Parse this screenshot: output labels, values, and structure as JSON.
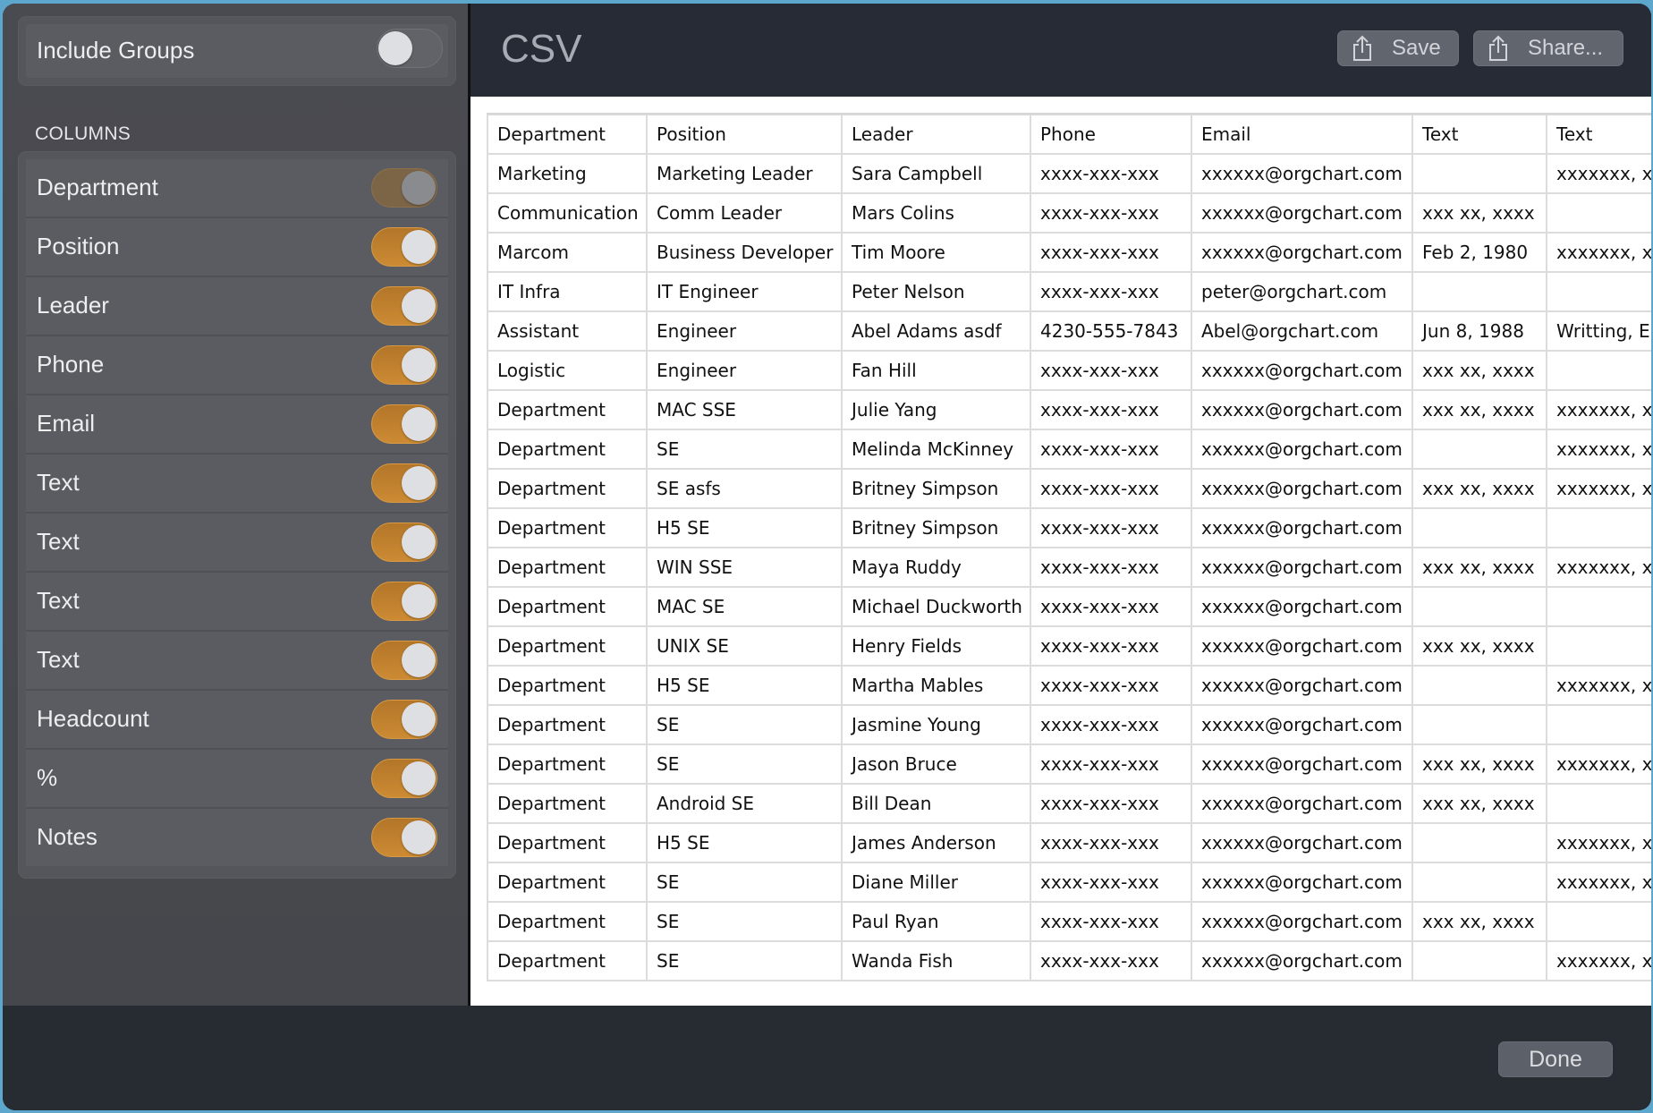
{
  "sidebar": {
    "include_groups": {
      "label": "Include Groups",
      "on": false
    },
    "columns_title": "COLUMNS",
    "columns": [
      {
        "label": "Department",
        "on": true,
        "disabled": true
      },
      {
        "label": "Position",
        "on": true
      },
      {
        "label": "Leader",
        "on": true
      },
      {
        "label": "Phone",
        "on": true
      },
      {
        "label": "Email",
        "on": true
      },
      {
        "label": "Text",
        "on": true
      },
      {
        "label": "Text",
        "on": true
      },
      {
        "label": "Text",
        "on": true
      },
      {
        "label": "Text",
        "on": true
      },
      {
        "label": "Headcount",
        "on": true
      },
      {
        "label": "%",
        "on": true
      },
      {
        "label": "Notes",
        "on": true
      }
    ]
  },
  "header": {
    "title": "CSV",
    "save_label": "Save",
    "share_label": "Share...",
    "save_icon": "share-box-icon",
    "share_icon": "share-box-icon"
  },
  "table": {
    "headers": [
      "Department",
      "Position",
      "Leader",
      "Phone",
      "Email",
      "Text",
      "Text"
    ],
    "rows": [
      [
        "Marketing",
        "Marketing Leader",
        "Sara Campbell",
        "xxxx-xxx-xxx",
        "xxxxxx@orgchart.com",
        "",
        "xxxxxxx, x"
      ],
      [
        "Communication",
        "Comm Leader",
        "Mars Colins",
        "xxxx-xxx-xxx",
        "xxxxxx@orgchart.com",
        "xxx xx, xxxx",
        ""
      ],
      [
        "Marcom",
        "Business Developer",
        "Tim Moore",
        "xxxx-xxx-xxx",
        "xxxxxx@orgchart.com",
        "Feb 2, 1980",
        "xxxxxxx, x"
      ],
      [
        "IT Infra",
        "IT Engineer",
        "Peter Nelson",
        "xxxx-xxx-xxx",
        "peter@orgchart.com",
        "",
        ""
      ],
      [
        "Assistant",
        "Engineer",
        "Abel Adams asdf",
        "4230-555-7843",
        "Abel@orgchart.com",
        "Jun 8, 1988",
        "Writting, E"
      ],
      [
        "Logistic",
        "Engineer",
        "Fan Hill",
        "xxxx-xxx-xxx",
        "xxxxxx@orgchart.com",
        "xxx xx, xxxx",
        ""
      ],
      [
        "Department",
        "MAC SSE",
        "Julie Yang",
        "xxxx-xxx-xxx",
        "xxxxxx@orgchart.com",
        "xxx xx, xxxx",
        "xxxxxxx, x"
      ],
      [
        "Department",
        "SE",
        "Melinda McKinney",
        "xxxx-xxx-xxx",
        "xxxxxx@orgchart.com",
        "",
        "xxxxxxx, x"
      ],
      [
        "Department",
        "SE asfs",
        "Britney Simpson",
        "xxxx-xxx-xxx",
        "xxxxxx@orgchart.com",
        "xxx xx, xxxx",
        "xxxxxxx, x"
      ],
      [
        "Department",
        "H5 SE",
        "Britney Simpson",
        "xxxx-xxx-xxx",
        "xxxxxx@orgchart.com",
        "",
        ""
      ],
      [
        "Department",
        "WIN SSE",
        "Maya Ruddy",
        "xxxx-xxx-xxx",
        "xxxxxx@orgchart.com",
        "xxx xx, xxxx",
        "xxxxxxx, x"
      ],
      [
        "Department",
        "MAC SE",
        "Michael Duckworth",
        "xxxx-xxx-xxx",
        "xxxxxx@orgchart.com",
        "",
        ""
      ],
      [
        "Department",
        "UNIX SE",
        "Henry Fields",
        "xxxx-xxx-xxx",
        "xxxxxx@orgchart.com",
        "xxx xx, xxxx",
        ""
      ],
      [
        "Department",
        "H5 SE",
        "Martha Mables",
        "xxxx-xxx-xxx",
        "xxxxxx@orgchart.com",
        "",
        "xxxxxxx, x"
      ],
      [
        "Department",
        "SE",
        "Jasmine Young",
        "xxxx-xxx-xxx",
        "xxxxxx@orgchart.com",
        "",
        ""
      ],
      [
        "Department",
        "SE",
        "Jason Bruce",
        "xxxx-xxx-xxx",
        "xxxxxx@orgchart.com",
        "xxx xx, xxxx",
        "xxxxxxx, x"
      ],
      [
        "Department",
        "Android SE",
        "Bill Dean",
        "xxxx-xxx-xxx",
        "xxxxxx@orgchart.com",
        "xxx xx, xxxx",
        ""
      ],
      [
        "Department",
        "H5 SE",
        "James Anderson",
        "xxxx-xxx-xxx",
        "xxxxxx@orgchart.com",
        "",
        "xxxxxxx, x"
      ],
      [
        "Department",
        "SE",
        "Diane Miller",
        "xxxx-xxx-xxx",
        "xxxxxx@orgchart.com",
        "",
        "xxxxxxx, x"
      ],
      [
        "Department",
        "SE",
        "Paul Ryan",
        "xxxx-xxx-xxx",
        "xxxxxx@orgchart.com",
        "xxx xx, xxxx",
        ""
      ],
      [
        "Department",
        "SE",
        "Wanda Fish",
        "xxxx-xxx-xxx",
        "xxxxxx@orgchart.com",
        "",
        "xxxxxxx, x"
      ]
    ]
  },
  "footer": {
    "done_label": "Done"
  },
  "colors": {
    "accent_toggle": "#cc8a33",
    "sidebar_bg": "#48494e",
    "header_bg": "#262b35",
    "footer_bg": "#272b32",
    "desktop_bg": "#5ea7cc"
  }
}
